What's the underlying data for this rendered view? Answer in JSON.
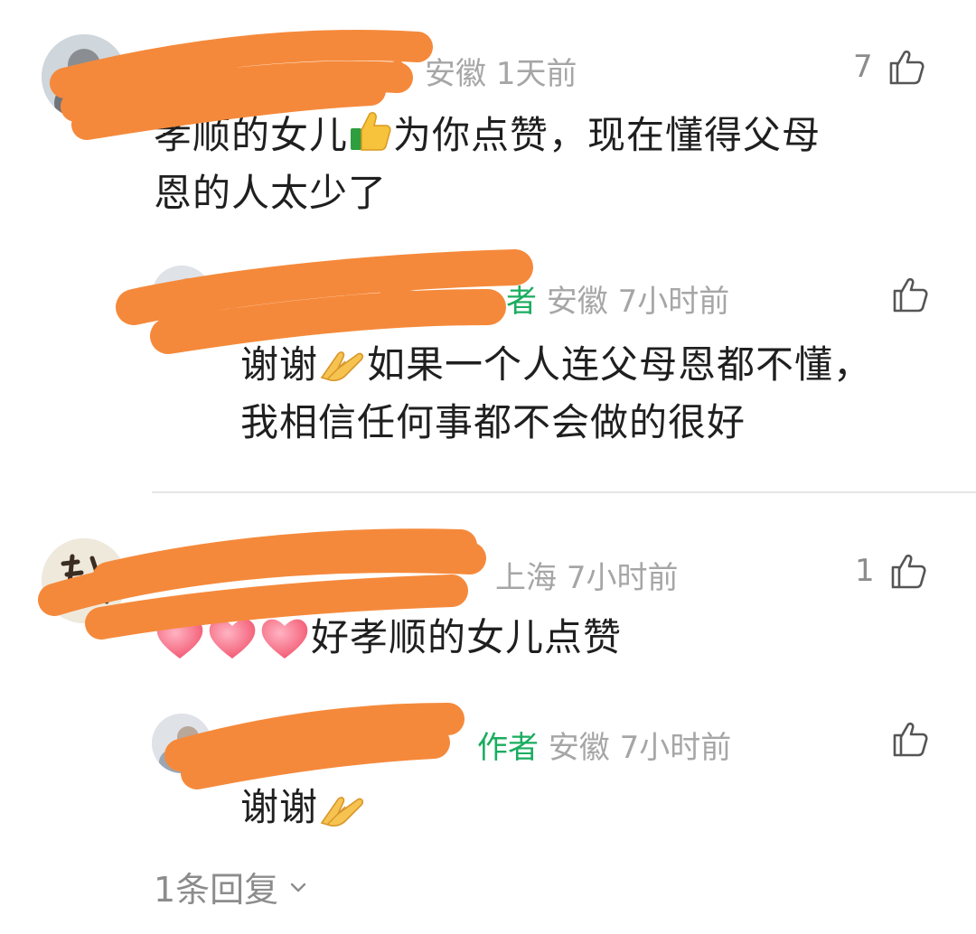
{
  "comments": [
    {
      "location": "安徽",
      "time": "1天前",
      "likes": "7",
      "text_line1": "孝顺的女儿",
      "text_line1b": "为你点赞，现在懂得父母",
      "text_line2": "恩的人太少了",
      "reply": {
        "tag_partial": "者",
        "location": "安徽",
        "time": "7小时前",
        "text_line1a": "谢谢",
        "text_line1b": "如果一个人连父母恩都不懂，",
        "text_line2": "我相信任何事都不会做的很好"
      }
    },
    {
      "location": "上海",
      "time": "7小时前",
      "likes": "1",
      "text": "好孝顺的女儿点赞",
      "reply": {
        "tag": "作者",
        "location": "安徽",
        "time": "7小时前",
        "text": "谢谢"
      },
      "more_replies": "1条回复"
    }
  ],
  "colors": {
    "author_tag": "#1aad5f",
    "scribble": "#f5893b",
    "meta": "#a6a6a6"
  },
  "icons": [
    "thumbs-up-outline-icon",
    "chevron-down-icon",
    "thumbs-up-emoji",
    "praying-hands-emoji",
    "heart-emoji"
  ]
}
